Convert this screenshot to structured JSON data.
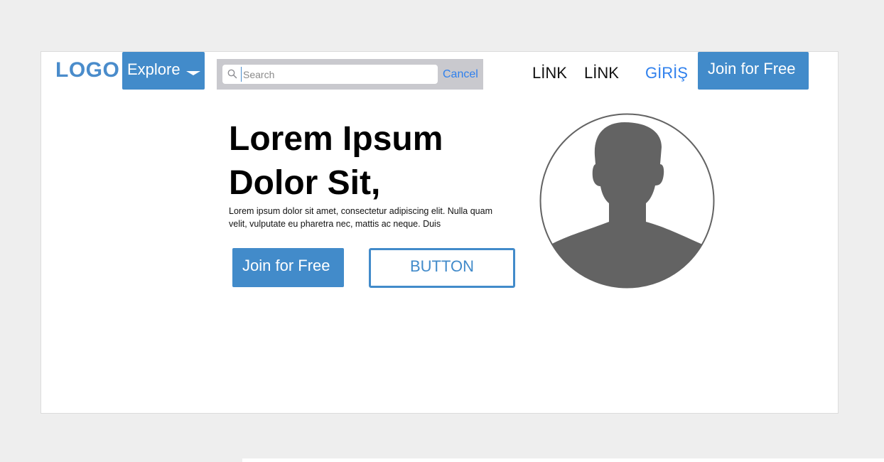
{
  "brand": {
    "logo": "LOGO"
  },
  "header": {
    "explore_label": "Explore",
    "search": {
      "placeholder": "Search",
      "cancel_label": "Cancel"
    },
    "links": [
      "LİNK",
      "LİNK"
    ],
    "login_label": "GİRİŞ",
    "join_label": "Join for Free"
  },
  "hero": {
    "title_line1": "Lorem Ipsum",
    "title_line2": "Dolor Sit,",
    "body": "Lorem ipsum dolor sit amet, consectetur adipiscing elit. Nulla quam velit, vulputate eu pharetra nec, mattis ac neque. Duis",
    "primary_button": "Join for Free",
    "secondary_button": "BUTTON"
  },
  "icons": {
    "search": "search-icon",
    "explore_caret": "chevron-down-icon",
    "avatar": "user-avatar-icon"
  },
  "colors": {
    "accent": "#428bca",
    "link_blue": "#2f80ed",
    "background": "#eeeeee",
    "avatar_gray": "#636363"
  }
}
